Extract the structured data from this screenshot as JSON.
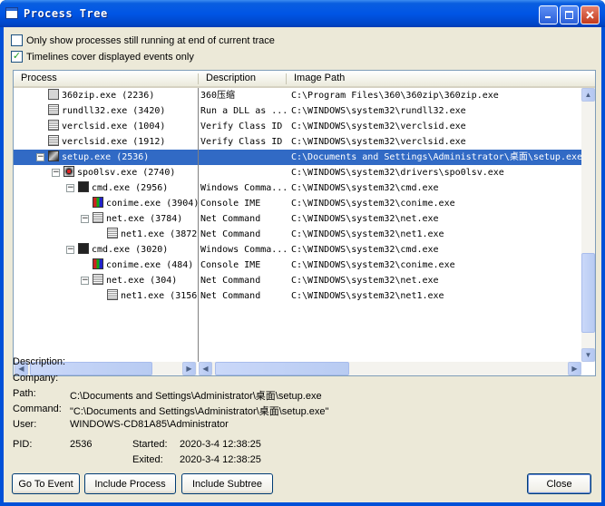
{
  "window": {
    "title": "Process Tree"
  },
  "options": {
    "only_running_label": "Only show processes still running at end of current trace",
    "only_running_checked": false,
    "timelines_label": "Timelines cover displayed events only",
    "timelines_checked": true,
    "check_mark": "✓"
  },
  "tree": {
    "columns": {
      "process": "Process",
      "description": "Description",
      "image_path": "Image Path"
    },
    "rows": [
      {
        "name": "360zip.exe (2236)",
        "desc": "360压缩",
        "path": "C:\\Program Files\\360\\360zip\\360zip.exe"
      },
      {
        "name": "rundll32.exe (3420)",
        "desc": "Run a DLL as ...",
        "path": "C:\\WINDOWS\\system32\\rundll32.exe"
      },
      {
        "name": "verclsid.exe (1004)",
        "desc": "Verify Class ID",
        "path": "C:\\WINDOWS\\system32\\verclsid.exe"
      },
      {
        "name": "verclsid.exe (1912)",
        "desc": "Verify Class ID",
        "path": "C:\\WINDOWS\\system32\\verclsid.exe"
      },
      {
        "name": "setup.exe (2536)",
        "desc": "",
        "path": "C:\\Documents and Settings\\Administrator\\桌面\\setup.exe"
      },
      {
        "name": "spo0lsv.exe (2740)",
        "desc": "",
        "path": "C:\\WINDOWS\\system32\\drivers\\spo0lsv.exe"
      },
      {
        "name": "cmd.exe (2956)",
        "desc": "Windows Comma...",
        "path": "C:\\WINDOWS\\system32\\cmd.exe"
      },
      {
        "name": "conime.exe (3904)",
        "desc": "Console IME",
        "path": "C:\\WINDOWS\\system32\\conime.exe"
      },
      {
        "name": "net.exe (3784)",
        "desc": "Net Command",
        "path": "C:\\WINDOWS\\system32\\net.exe"
      },
      {
        "name": "net1.exe (3872)",
        "desc": "Net Command",
        "path": "C:\\WINDOWS\\system32\\net1.exe"
      },
      {
        "name": "cmd.exe (3020)",
        "desc": "Windows Comma...",
        "path": "C:\\WINDOWS\\system32\\cmd.exe"
      },
      {
        "name": "conime.exe (484)",
        "desc": "Console IME",
        "path": "C:\\WINDOWS\\system32\\conime.exe"
      },
      {
        "name": "net.exe (304)",
        "desc": "Net Command",
        "path": "C:\\WINDOWS\\system32\\net.exe"
      },
      {
        "name": "net1.exe (3156)",
        "desc": "Net Command",
        "path": "C:\\WINDOWS\\system32\\net1.exe"
      }
    ]
  },
  "details": {
    "description_label": "Description:",
    "company_label": "Company:",
    "path_label": "Path:",
    "path_value": "C:\\Documents and Settings\\Administrator\\桌面\\setup.exe",
    "command_label": "Command:",
    "command_value": "\"C:\\Documents and Settings\\Administrator\\桌面\\setup.exe\"",
    "user_label": "User:",
    "user_value": "WINDOWS-CD81A85\\Administrator",
    "pid_label": "PID:",
    "pid_value": "2536",
    "started_label": "Started:",
    "started_value": "2020-3-4 12:38:25",
    "exited_label": "Exited:",
    "exited_value": "2020-3-4 12:38:25"
  },
  "buttons": {
    "go_to_event": "Go To Event",
    "include_process": "Include Process",
    "include_subtree": "Include Subtree",
    "close": "Close"
  }
}
